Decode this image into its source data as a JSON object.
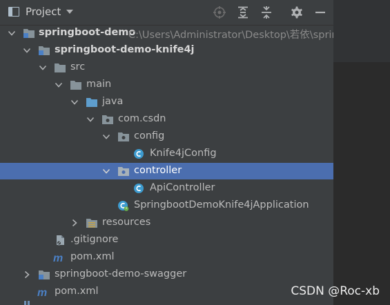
{
  "header": {
    "title": "Project",
    "buttons": [
      "locate-icon",
      "expand-all-icon",
      "collapse-all-icon",
      "gear-icon",
      "minimize-icon"
    ]
  },
  "tree": {
    "root": {
      "label": "springboot-demo",
      "path": "C:\\Users\\Administrator\\Desktop\\若依\\spring"
    },
    "module_knife4j": {
      "label": "springboot-demo-knife4j"
    },
    "src": {
      "label": "src"
    },
    "main": {
      "label": "main"
    },
    "java": {
      "label": "java"
    },
    "package": {
      "label": "com.csdn"
    },
    "config": {
      "label": "config"
    },
    "knife4j_config": {
      "label": "Knife4jConfig"
    },
    "controller": {
      "label": "controller"
    },
    "api_controller": {
      "label": "ApiController"
    },
    "application": {
      "label": "SpringbootDemoKnife4jApplication"
    },
    "resources": {
      "label": "resources"
    },
    "gitignore": {
      "label": ".gitignore"
    },
    "pom_module": {
      "label": "pom.xml"
    },
    "module_swagger": {
      "label": "springboot-demo-swagger"
    },
    "pom_root": {
      "label": "pom.xml"
    }
  },
  "colors": {
    "selection": "#4b6eaf",
    "folder": "#87939a",
    "source_folder": "#5e9ece",
    "class_icon": "#3d9bcf",
    "maven": "#4b80c5"
  },
  "watermark": "CSDN @Roc-xb"
}
